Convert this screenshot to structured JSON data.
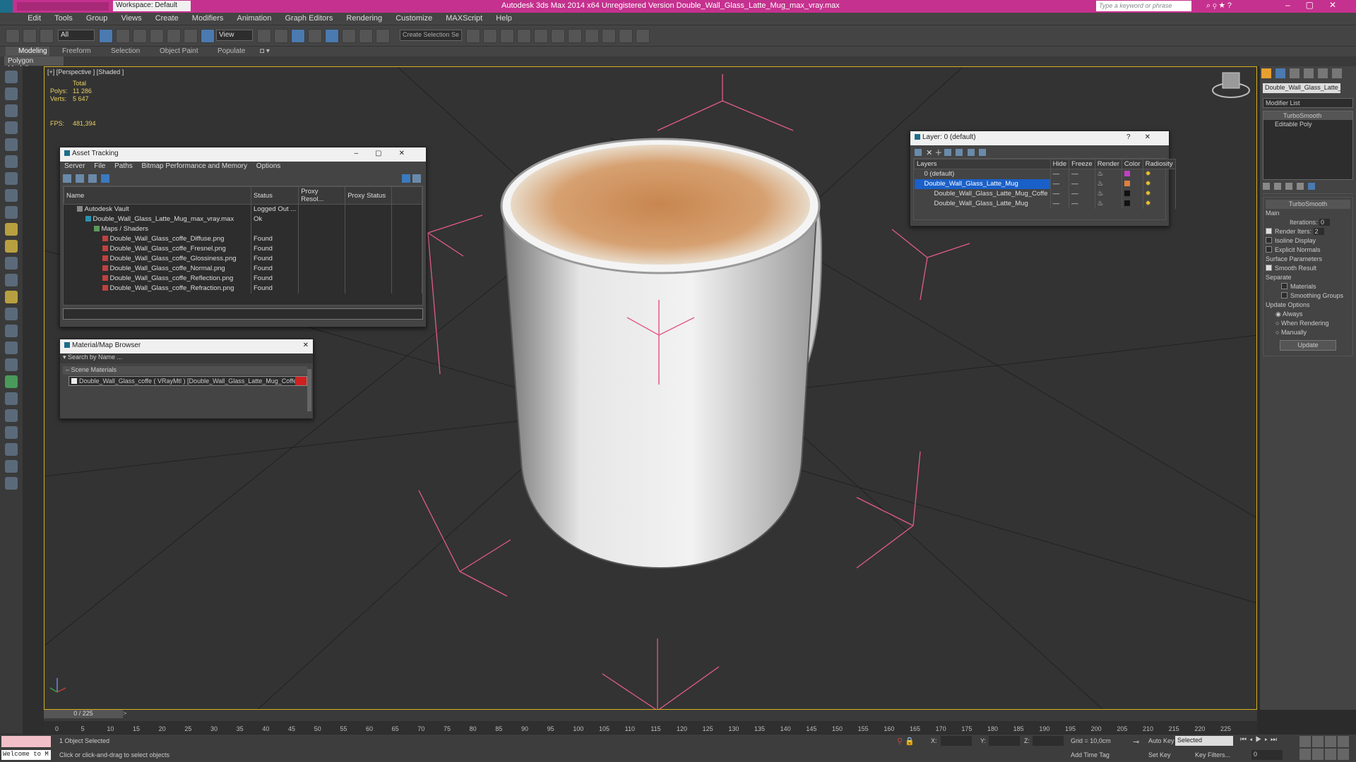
{
  "window": {
    "workspace": "Workspace: Default",
    "title": "Autodesk 3ds Max  2014 x64    Unregistered Version    Double_Wall_Glass_Latte_Mug_max_vray.max",
    "search_placeholder": "Type a keyword or phrase"
  },
  "menu": [
    "Edit",
    "Tools",
    "Group",
    "Views",
    "Create",
    "Modifiers",
    "Animation",
    "Graph Editors",
    "Rendering",
    "Customize",
    "MAXScript",
    "Help"
  ],
  "toolbar": {
    "filter": "All",
    "view": "View",
    "selection_set": "Create Selection Se"
  },
  "ribbon": {
    "tabs": [
      "Modeling",
      "Freeform",
      "Selection",
      "Object Paint",
      "Populate"
    ],
    "sub": "Polygon Modeling"
  },
  "viewport": {
    "label": "[+] [Perspective ] [Shaded ]",
    "stats_total": "Total",
    "polys_label": "Polys:",
    "polys": "11 286",
    "verts_label": "Verts:",
    "verts": "5 647",
    "fps_label": "FPS:",
    "fps": "481,394"
  },
  "asset_tracking": {
    "title": "Asset Tracking",
    "menu": [
      "Server",
      "File",
      "Paths",
      "Bitmap Performance and Memory",
      "Options"
    ],
    "columns": [
      "Name",
      "Status",
      "Proxy Resol...",
      "Proxy Status"
    ],
    "rows": [
      {
        "name": "Autodesk Vault",
        "status": "Logged Out ..."
      },
      {
        "name": "Double_Wall_Glass_Latte_Mug_max_vray.max",
        "status": "Ok"
      },
      {
        "name": "Maps / Shaders",
        "status": ""
      },
      {
        "name": "Double_Wall_Glass_coffe_Diffuse.png",
        "status": "Found"
      },
      {
        "name": "Double_Wall_Glass_coffe_Fresnel.png",
        "status": "Found"
      },
      {
        "name": "Double_Wall_Glass_coffe_Glossiness.png",
        "status": "Found"
      },
      {
        "name": "Double_Wall_Glass_coffe_Normal.png",
        "status": "Found"
      },
      {
        "name": "Double_Wall_Glass_coffe_Reflection.png",
        "status": "Found"
      },
      {
        "name": "Double_Wall_Glass_coffe_Refraction.png",
        "status": "Found"
      }
    ]
  },
  "material_browser": {
    "title": "Material/Map Browser",
    "search_placeholder": "Search by Name ...",
    "section": "Scene Materials",
    "item": "Double_Wall_Glass_coffe ( VRayMtl ) [Double_Wall_Glass_Latte_Mug_Coffe]"
  },
  "layer_window": {
    "title": "Layer: 0 (default)",
    "columns": [
      "Layers",
      "Hide",
      "Freeze",
      "Render",
      "Color",
      "Radiosity"
    ],
    "rows": [
      {
        "name": "0 (default)",
        "color": "#c040c0"
      },
      {
        "name": "Double_Wall_Glass_Latte_Mug",
        "color": "#e08040"
      },
      {
        "name": "Double_Wall_Glass_Latte_Mug_Coffe",
        "color": "#111111"
      },
      {
        "name": "Double_Wall_Glass_Latte_Mug",
        "color": "#111111"
      }
    ]
  },
  "command_panel": {
    "object_name": "Double_Wall_Glass_Latte_Mu",
    "modifier_list": "Modifier List",
    "stack": [
      "TurboSmooth",
      "Editable Poly"
    ],
    "rollout": "TurboSmooth",
    "main": "Main",
    "iterations_label": "Iterations:",
    "iterations": "0",
    "render_iters_label": "Render Iters:",
    "render_iters": "2",
    "isoline": "Isoline Display",
    "explicit": "Explicit Normals",
    "surface": "Surface Parameters",
    "smooth_result": "Smooth Result",
    "separate": "Separate",
    "materials": "Materials",
    "smoothing_groups": "Smoothing Groups",
    "update_options": "Update Options",
    "always": "Always",
    "when_rendering": "When Rendering",
    "manually": "Manually",
    "update_btn": "Update"
  },
  "timeline": {
    "frame": "0 / 225",
    "ticks": [
      "0",
      "5",
      "10",
      "15",
      "20",
      "25",
      "30",
      "35",
      "40",
      "45",
      "50",
      "55",
      "60",
      "65",
      "70",
      "75",
      "80",
      "85",
      "90",
      "95",
      "100",
      "105",
      "110",
      "115",
      "120",
      "125",
      "130",
      "135",
      "140",
      "145",
      "150",
      "155",
      "160",
      "165",
      "170",
      "175",
      "180",
      "185",
      "190",
      "195",
      "200",
      "205",
      "210",
      "215",
      "220",
      "225"
    ]
  },
  "status": {
    "maxscript": "Welcome to M",
    "selected": "1 Object Selected",
    "hint": "Click or click-and-drag to select objects",
    "x_label": "X:",
    "y_label": "Y:",
    "z_label": "Z:",
    "grid": "Grid = 10,0cm",
    "add_time_tag": "Add Time Tag",
    "auto_key": "Auto Key",
    "set_key": "Set Key",
    "selected_dropdown": "Selected",
    "key_filters": "Key Filters...",
    "frame_value": "0"
  }
}
